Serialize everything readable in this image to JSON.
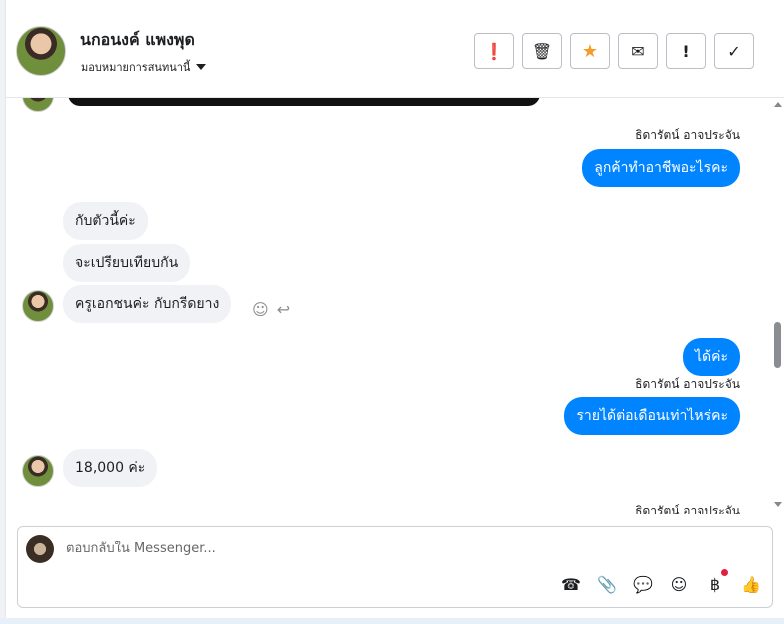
{
  "header": {
    "contact_name": "นกอนงค์ แพงพุด",
    "assign_label": "มอบหมายการสนทนานี้",
    "toolbar": [
      {
        "name": "spam-button",
        "glyph": "❗"
      },
      {
        "name": "delete-button",
        "glyph": "🗑"
      },
      {
        "name": "star-button",
        "glyph": "★"
      },
      {
        "name": "mark-unread-button",
        "glyph": "✉"
      },
      {
        "name": "important-button",
        "glyph": "!"
      },
      {
        "name": "done-button",
        "glyph": "✓"
      }
    ]
  },
  "messages": {
    "sender_1": "ธิดารัตน์ อาจประจัน",
    "out_1": "ลูกค้าทำอาชีพอะไรคะ",
    "in_1": "กับตัวนี้ค่ะ",
    "in_2": "จะเปรียบเทียบกัน",
    "in_3": "ครูเอกชนค่ะ กับกรีดยาง",
    "out_2": "ได้ค่ะ",
    "sender_2": "ธิดารัตน์ อาจประจัน",
    "out_3": "รายได้ต่อเดือนเท่าไหร่คะ",
    "in_4": "18,000 ค่ะ",
    "sender_3": "ธิดารัตน์ อาจประจัน"
  },
  "message_actions": {
    "react_glyph": "☺",
    "reply_glyph": "↩"
  },
  "composer": {
    "placeholder": "ตอบกลับใน Messenger...",
    "tools": [
      {
        "name": "call-add-icon",
        "glyph": "☎"
      },
      {
        "name": "attachment-icon",
        "glyph": "📎"
      },
      {
        "name": "saved-replies-icon",
        "glyph": "💬"
      },
      {
        "name": "emoji-icon",
        "glyph": "☺"
      },
      {
        "name": "payment-icon",
        "glyph": "฿"
      },
      {
        "name": "like-icon",
        "glyph": "👍"
      }
    ]
  },
  "colors": {
    "outgoing": "#0084ff",
    "incoming": "#f0f2f5",
    "star": "#f59b28",
    "badge": "#e41e3f"
  }
}
